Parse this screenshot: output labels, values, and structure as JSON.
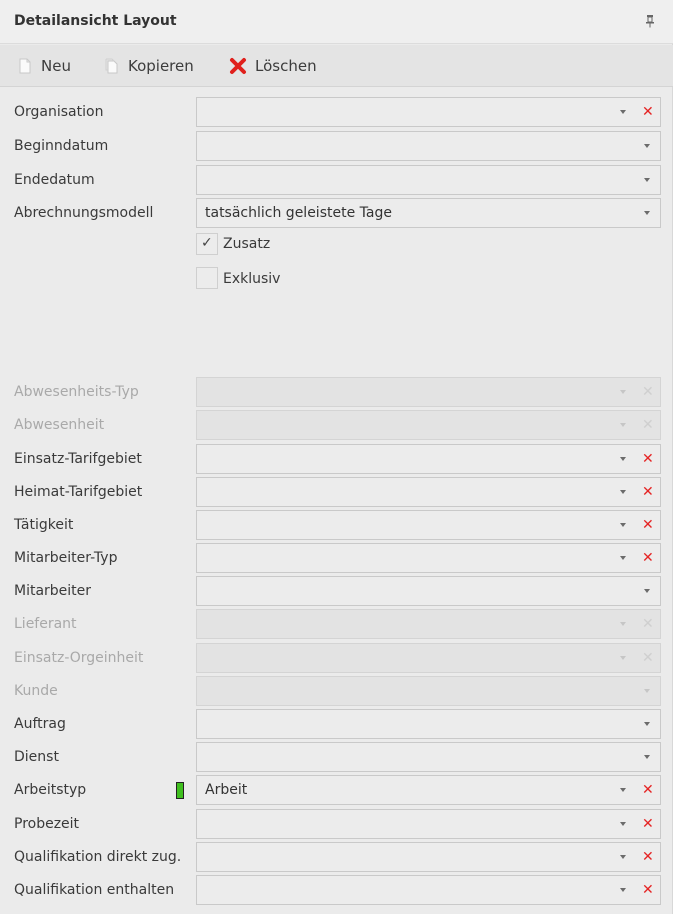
{
  "panel": {
    "title": "Detailansicht Layout",
    "pin_icon": "pin-icon"
  },
  "toolbar": {
    "new_label": "Neu",
    "copy_label": "Kopieren",
    "delete_label": "Löschen"
  },
  "form": {
    "organisation": {
      "label": "Organisation",
      "value": ""
    },
    "beginndatum": {
      "label": "Beginndatum",
      "value": ""
    },
    "endedatum": {
      "label": "Endedatum",
      "value": ""
    },
    "abrechnungsmodell": {
      "label": "Abrechnungsmodell",
      "value": "tatsächlich geleistete Tage"
    },
    "zusatz": {
      "label": "Zusatz",
      "checked": true
    },
    "exklusiv": {
      "label": "Exklusiv",
      "checked": false
    },
    "abwesenheits_typ": {
      "label": "Abwesenheits-Typ",
      "value": "",
      "disabled": true
    },
    "abwesenheit": {
      "label": "Abwesenheit",
      "value": "",
      "disabled": true
    },
    "einsatz_tarifgebiet": {
      "label": "Einsatz-Tarifgebiet",
      "value": ""
    },
    "heimat_tarifgebiet": {
      "label": "Heimat-Tarifgebiet",
      "value": ""
    },
    "taetigkeit": {
      "label": "Tätigkeit",
      "value": ""
    },
    "mitarbeiter_typ": {
      "label": "Mitarbeiter-Typ",
      "value": ""
    },
    "mitarbeiter": {
      "label": "Mitarbeiter",
      "value": ""
    },
    "lieferant": {
      "label": "Lieferant",
      "value": "",
      "disabled": true
    },
    "einsatz_orgeinheit": {
      "label": "Einsatz-Orgeinheit",
      "value": "",
      "disabled": true
    },
    "kunde": {
      "label": "Kunde",
      "value": "",
      "disabled": true
    },
    "auftrag": {
      "label": "Auftrag",
      "value": ""
    },
    "dienst": {
      "label": "Dienst",
      "value": ""
    },
    "arbeitstyp": {
      "label": "Arbeitstyp",
      "value": "Arbeit",
      "color": "#3fbf1f"
    },
    "probezeit": {
      "label": "Probezeit",
      "value": ""
    },
    "qualifikation_direkt": {
      "label": "Qualifikation direkt zug.",
      "value": ""
    },
    "qualifikation_enthalten": {
      "label": "Qualifikation enthalten",
      "value": ""
    }
  },
  "colors": {
    "clear_red": "#e52424",
    "delete_red": "#e0201c",
    "arbeit_green": "#3fbf1f"
  }
}
